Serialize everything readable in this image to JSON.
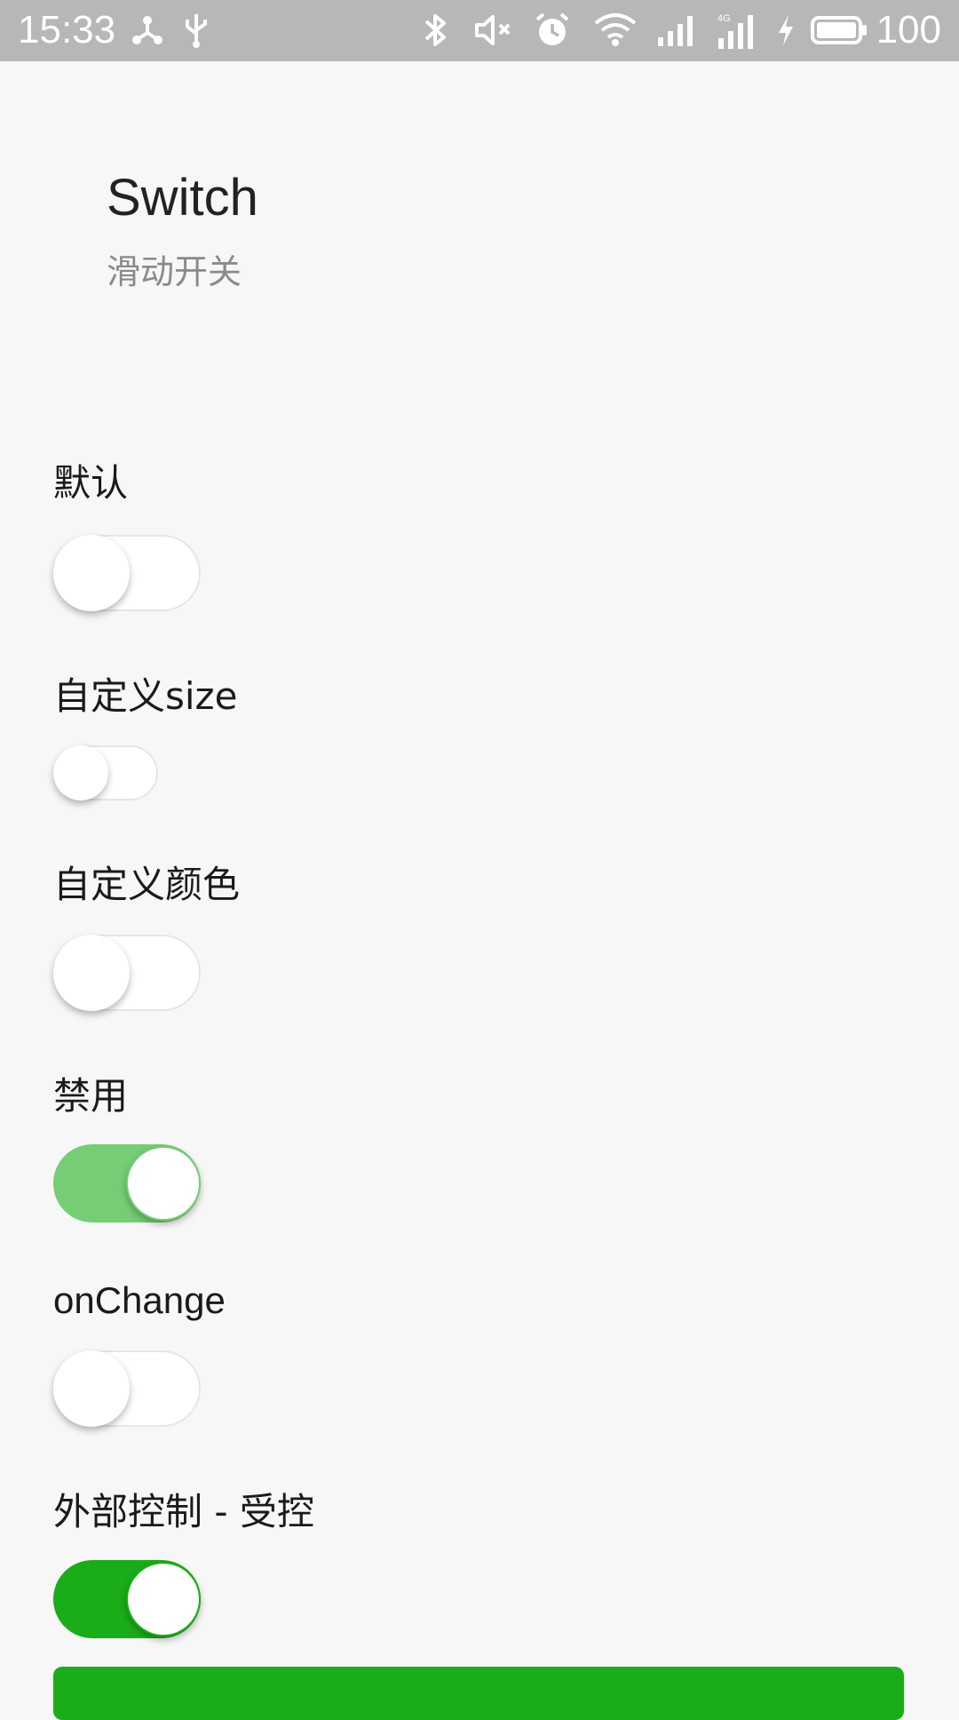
{
  "status_bar": {
    "time": "15:33",
    "battery_percent": "100",
    "icons": [
      "usb-tether-icon",
      "usb-icon",
      "bluetooth-icon",
      "mute-icon",
      "alarm-icon",
      "wifi-icon",
      "signal-icon",
      "4g-signal-icon",
      "charging-icon",
      "battery-icon"
    ]
  },
  "header": {
    "title": "Switch",
    "description": "滑动开关"
  },
  "sections": [
    {
      "label": "默认",
      "checked": false,
      "color": "#ffffff"
    },
    {
      "label": "自定义size",
      "checked": false,
      "color": "#ffffff"
    },
    {
      "label": "自定义颜色",
      "checked": false,
      "color": "#ffffff"
    },
    {
      "label": "禁用",
      "checked": true,
      "disabled": true,
      "color": "#76cd76"
    },
    {
      "label": "onChange",
      "checked": false,
      "color": "#ffffff"
    },
    {
      "label": "外部控制 - 受控",
      "checked": true,
      "color": "#1aad19"
    }
  ],
  "colors": {
    "accent": "#1aad19",
    "disabled_on": "#76cd76",
    "background": "#f7f7f7",
    "status_bar": "#b7b7b7"
  }
}
